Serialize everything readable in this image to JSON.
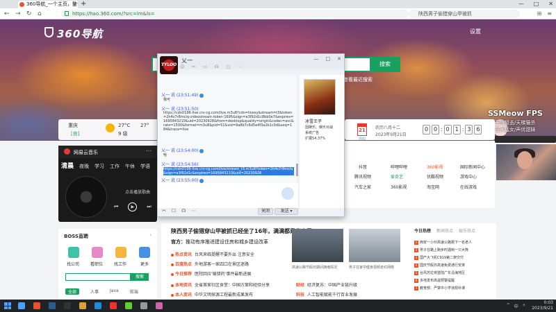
{
  "browser": {
    "tab_title": "360导航_一个主页，整个世界",
    "new_tab": "+",
    "url": "https://hao.360.com/?src=lm&ls=",
    "search_placeholder": "陕西男子偷猎穿山甲被抓",
    "win_min": "—",
    "win_max": "□",
    "win_close": "✕",
    "back": "←",
    "forward": "→",
    "reload": "↻",
    "home": "⌂"
  },
  "hero": {
    "logo": "360导航",
    "settings": "设置",
    "search_button": "搜索",
    "search_hint": "查看最近搜索"
  },
  "weather": {
    "city": "重庆",
    "aqi": "[良]",
    "temp": "27°C",
    "level": "9 级",
    "temp2": "27°"
  },
  "stream": {
    "label": "SSMeow FPS",
    "line1": "王牌狙击/天梯猫杀",
    "line2": "技术猛女/声优甜妹"
  },
  "music": {
    "title": "网易云音乐",
    "more": "⋯",
    "tabs": [
      "清晨",
      "夜晚",
      "学习",
      "工作",
      "午休",
      "学语"
    ],
    "status": "点击播放歌曲",
    "prev": "⏮",
    "play": "▶",
    "next": "⏭"
  },
  "chat": {
    "name": "乂一",
    "win_min": "—",
    "win_max": "□",
    "win_close": "✕",
    "tools": [
      "☺",
      "✂",
      "▭",
      "☊",
      "▢",
      "⋯"
    ],
    "messages": [
      {
        "name": "乂一 说 (23:51:49)",
        "body": "我可"
      },
      {
        "name": "乂一 说 (23:51:50)",
        "body": "https://cdn0196-live.crv-cg.com/live.m3u8?cdn=livexy&stream=t3&token=2h4s7r8mclq-videostream-token-1695&sign=a3f92d1c8bb0e7&expires=1695843210&uid=20230928&from=desktop&quality=origin&codec=avc&rate=1500&format=m3u8&pid=51&vid=9a8b7c6d5e4f3a2b1c0d&seq=184&trace=live"
      },
      {
        "name": "乂一 说 (23:54:00)",
        "body": "哈"
      },
      {
        "name": "乂一 说 (23:54:56)",
        "body": "https://cdn0196-live.crv-cg.com/live/stream_t3.m3u8?token=2h4s7r8mclq&sign=a3f92d1c&expires=1695843210&uid=20230928"
      },
      {
        "name": "乂一 说 (23:55:00)",
        "body": ""
      }
    ],
    "close_btn": "关闭",
    "send_btn": "发送 ▾",
    "input_tools": [
      "✂",
      "☐",
      "☊",
      "⋯"
    ],
    "game_title": "冰雪王子",
    "game_lines": [
      "因娱乐、娱乐对战",
      "系统广告",
      "扩展54.37%"
    ]
  },
  "timepanel": {
    "day": "21",
    "weekday": "周四",
    "lunar1": "农历八月十二",
    "lunar2": "2023年9月21日",
    "clock": [
      "0",
      "0",
      "0",
      "1",
      "3",
      "6"
    ]
  },
  "sites": [
    "抖音",
    "哔哩哔哩",
    "360影视",
    "国际新闻中心",
    "腾讯视频",
    "爱奇艺",
    "优酷视频",
    "游戏中心",
    "汽车之家",
    "360影视",
    "淘宝网",
    "在线游戏"
  ],
  "news": {
    "headline1": "陕西男子偷猎穿山甲被抓已经坐了16年，满满都是穿山甲",
    "headline2_bold": "官方：",
    "headline2": "推动有序推进建设住房和城乡建设改革",
    "items": [
      {
        "cat": "热点资讯",
        "text": "台风来临提醒不要外出 注意安全"
      },
      {
        "cat": "百度热点",
        "text": "外地游客一家四口在景区迷路"
      },
      {
        "cat": "今日推荐",
        "text": "医院回应'输错药'事件最新进展"
      },
      {
        "cat": "本地资讯",
        "text": "全省首家社区食堂：中国方案和经验分享"
      },
      {
        "cat": "本人资讯",
        "text": "中华文明探源工程最新成果发布"
      }
    ],
    "right_items": [
      {
        "cat": "财经",
        "text": "经济复苏：中国产业链升级"
      },
      {
        "cat": "科技",
        "text": "人工智能赋能千行百业发展"
      }
    ],
    "img1_caption": "高速公路节假日期间拥堵情况",
    "img2_caption": "男子在家中健身视频走红网络"
  },
  "hot": {
    "tabs": [
      "今日热榜",
      "新闻热点",
      "娱乐热点"
    ],
    "rows": [
      "西安一小伙高速公路救下一名老人",
      "男子在路上跑步时遇到一只大熊",
      "国产大飞机C919第二架交付",
      "国庆节假日高速免费通行安排",
      "台风苏拉将登陆广东沿海地区",
      "多地发布高温预警提醒",
      "教育部：严禁中小学违规补课"
    ]
  },
  "boss": {
    "title": "BOSS直聘",
    "arrow": "›",
    "labels": [
      "找公司",
      "看职位",
      "找工作",
      "更多"
    ],
    "search_button": "搜索",
    "tags": [
      "全部",
      "人事",
      "Java",
      "前端"
    ]
  },
  "taskbar": {
    "time": "0:03",
    "date": "2023/9/21",
    "tray": [
      "^",
      "中",
      "⚡"
    ]
  },
  "colors": {
    "brand_green": "#1aa060",
    "accent_orange": "#e8542a",
    "select_blue": "#2c7be5"
  }
}
